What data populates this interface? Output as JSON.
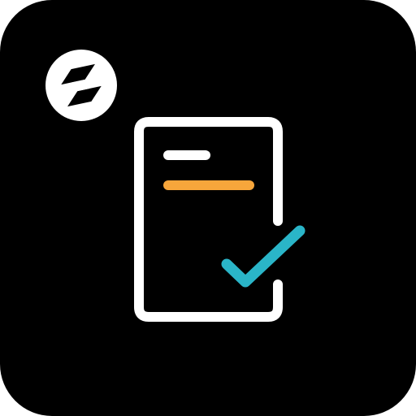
{
  "icon": {
    "background_color": "#000000",
    "logo": {
      "icon_name": "brand-logo-icon",
      "circle_color": "#ffffff",
      "mark_color": "#000000"
    },
    "document": {
      "icon_name": "document-icon",
      "stroke_color": "#ffffff",
      "short_line_color": "#ffffff",
      "long_line_color": "#f7a63b"
    },
    "checkmark": {
      "icon_name": "checkmark-icon",
      "color": "#2ab5c8"
    }
  }
}
